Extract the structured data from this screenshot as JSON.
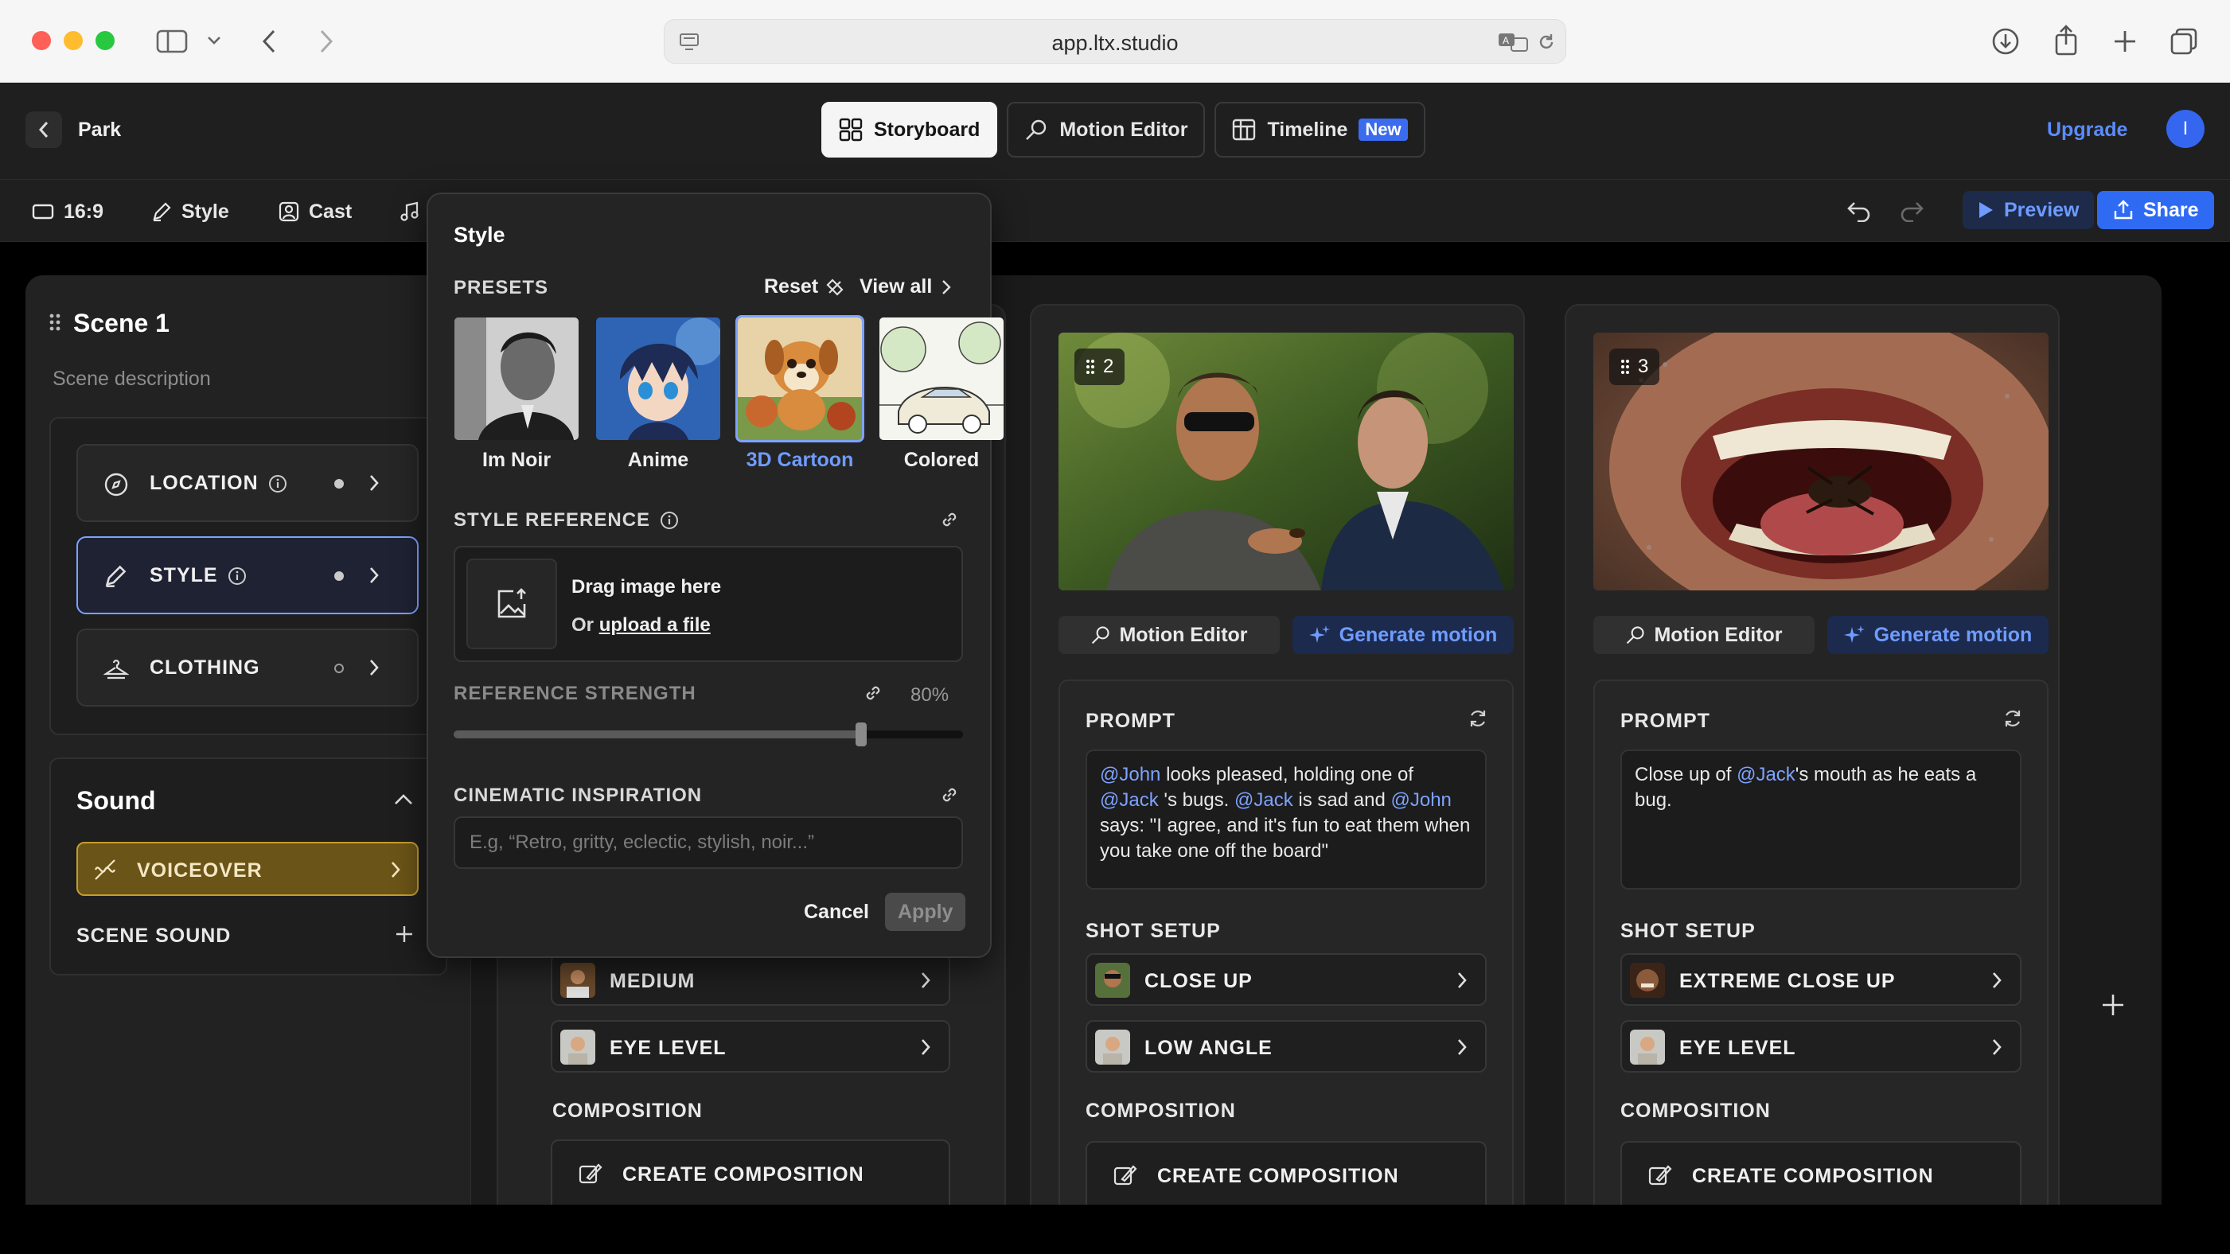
{
  "browser": {
    "url": "app.ltx.studio"
  },
  "header": {
    "project_title": "Park",
    "tabs": [
      {
        "label": "Storyboard",
        "active": true
      },
      {
        "label": "Motion Editor",
        "active": false
      },
      {
        "label": "Timeline",
        "badge": "New",
        "active": false
      }
    ],
    "upgrade_label": "Upgrade",
    "avatar_initial": "I"
  },
  "toolbar": {
    "aspect_ratio": "16:9",
    "style_label": "Style",
    "cast_label": "Cast",
    "preview_label": "Preview",
    "share_label": "Share"
  },
  "scene": {
    "title": "Scene 1",
    "description_placeholder": "Scene description",
    "options": [
      {
        "label": "LOCATION",
        "status": "filled"
      },
      {
        "label": "STYLE",
        "status": "filled",
        "selected": true
      },
      {
        "label": "CLOTHING",
        "status": "empty"
      }
    ],
    "sound": {
      "title": "Sound",
      "voiceover_label": "VOICEOVER",
      "scene_sound_label": "SCENE SOUND"
    }
  },
  "style_popover": {
    "title": "Style",
    "presets_label": "PRESETS",
    "reset_label": "Reset",
    "view_all_label": "View all",
    "presets": [
      {
        "label": "Im Noir",
        "selected": false
      },
      {
        "label": "Anime",
        "selected": false
      },
      {
        "label": "3D Cartoon",
        "selected": true
      },
      {
        "label": "Colored",
        "selected": false
      }
    ],
    "style_reference_label": "STYLE REFERENCE",
    "drag_text": "Drag image here",
    "or_text": "Or",
    "upload_link": "upload a file",
    "reference_strength_label": "REFERENCE STRENGTH",
    "reference_strength_value": "80%",
    "reference_strength_fraction": 0.8,
    "cinematic_label": "CINEMATIC INSPIRATION",
    "cinematic_placeholder": "E.g, “Retro, gritty, eclectic, stylish, noir...”",
    "cancel_label": "Cancel",
    "apply_label": "Apply"
  },
  "shots": {
    "shot1": {
      "shot_setup": [
        "MEDIUM",
        "EYE LEVEL"
      ],
      "composition_label": "COMPOSITION",
      "create_composition_label": "CREATE COMPOSITION"
    },
    "shot2": {
      "number": "2",
      "motion_editor_label": "Motion Editor",
      "generate_motion_label": "Generate motion",
      "prompt_label": "PROMPT",
      "prompt_parts": [
        "@John",
        " looks pleased, holding one of ",
        "@Jack",
        " 's bugs. ",
        "@Jack",
        " is sad and ",
        "@John",
        "  says: \"I agree, and it's fun to eat them when you take one off the board\""
      ],
      "shot_setup_label": "SHOT SETUP",
      "shot_setup": [
        "CLOSE UP",
        "LOW ANGLE"
      ],
      "composition_label": "COMPOSITION",
      "create_composition_label": "CREATE COMPOSITION"
    },
    "shot3": {
      "number": "3",
      "motion_editor_label": "Motion Editor",
      "generate_motion_label": "Generate motion",
      "prompt_label": "PROMPT",
      "prompt_parts": [
        "Close up of ",
        "@Jack",
        "'s mouth as he eats a bug."
      ],
      "shot_setup_label": "SHOT SETUP",
      "shot_setup": [
        "EXTREME CLOSE UP",
        "EYE LEVEL"
      ],
      "composition_label": "COMPOSITION",
      "create_composition_label": "CREATE COMPOSITION"
    }
  },
  "colors": {
    "accent": "#2f6bf2",
    "mention": "#7ea2ff",
    "voiceover": "#c59d2e"
  }
}
